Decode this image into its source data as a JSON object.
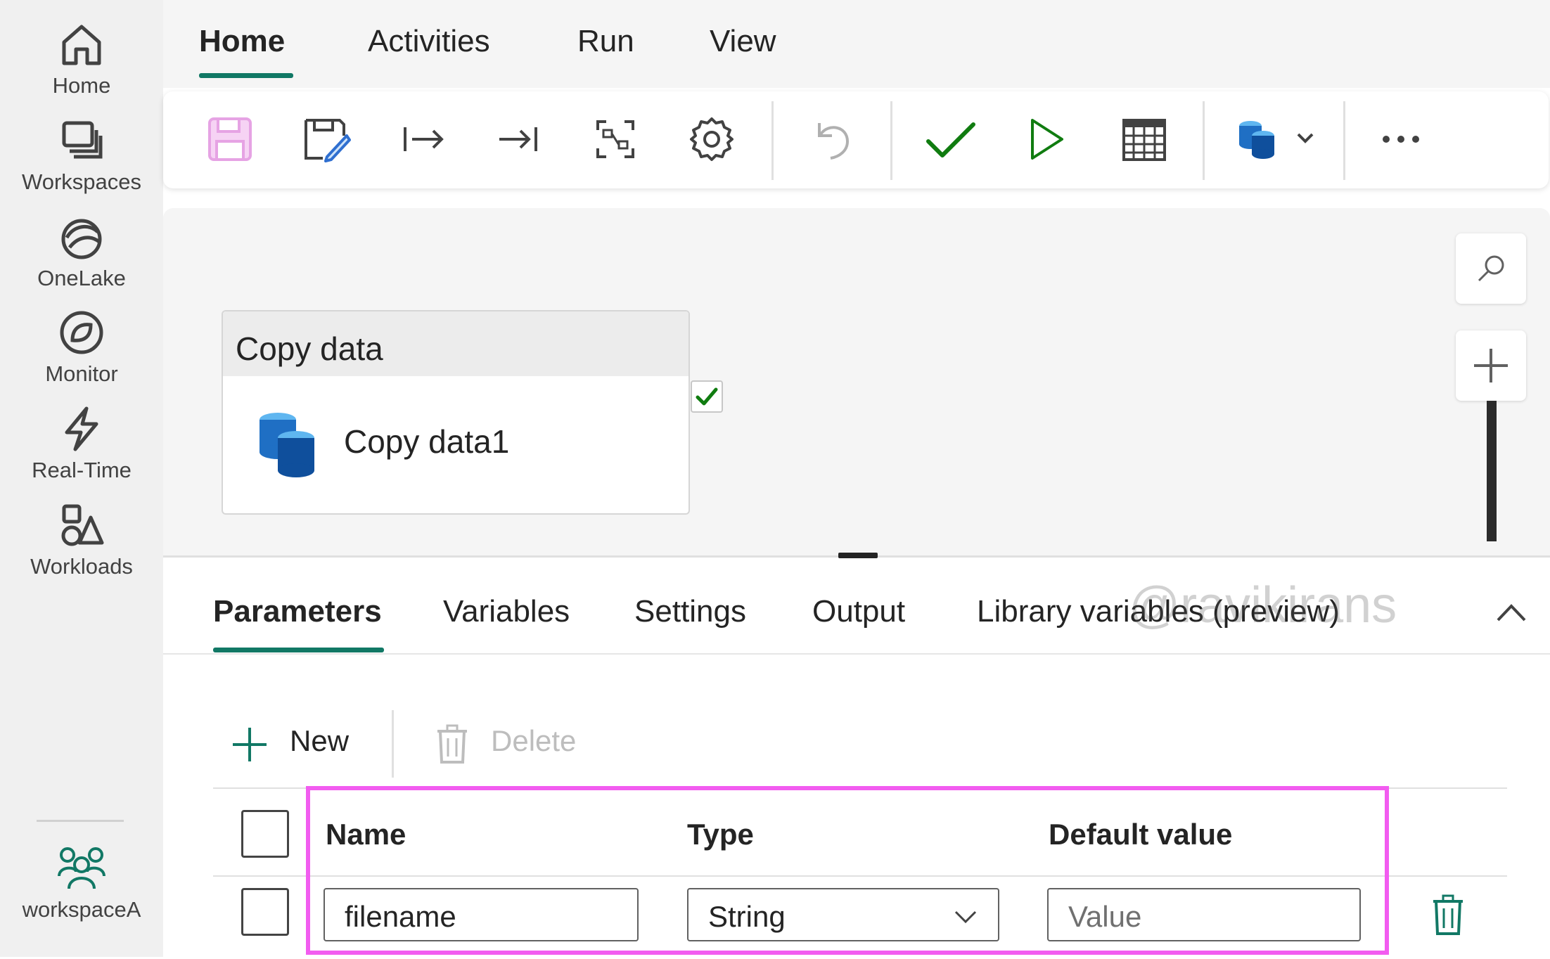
{
  "rail": {
    "items": [
      {
        "label": "Home",
        "icon": "home-icon"
      },
      {
        "label": "Workspaces",
        "icon": "workspaces-icon"
      },
      {
        "label": "OneLake",
        "icon": "onelake-icon"
      },
      {
        "label": "Monitor",
        "icon": "monitor-icon"
      },
      {
        "label": "Real-Time",
        "icon": "real-time-icon"
      },
      {
        "label": "Workloads",
        "icon": "workloads-icon"
      },
      {
        "label": "workspaceA",
        "icon": "workspace-people-icon"
      }
    ]
  },
  "menu": {
    "tabs": [
      {
        "label": "Home",
        "active": true
      },
      {
        "label": "Activities",
        "active": false
      },
      {
        "label": "Run",
        "active": false
      },
      {
        "label": "View",
        "active": false
      }
    ]
  },
  "toolbar": {
    "buttons": [
      "save-icon",
      "save-as-icon",
      "indent-icon",
      "outdent-icon",
      "auto-align-icon",
      "settings-gear-icon",
      "undo-icon",
      "validate-check-icon",
      "run-play-icon",
      "schedule-calendar-icon",
      "copy-data-dropdown-icon",
      "more-options-icon"
    ]
  },
  "canvas": {
    "activity": {
      "type_label": "Copy data",
      "name": "Copy data1"
    }
  },
  "panel": {
    "tabs": [
      {
        "label": "Parameters",
        "active": true
      },
      {
        "label": "Variables",
        "active": false
      },
      {
        "label": "Settings",
        "active": false
      },
      {
        "label": "Output",
        "active": false
      },
      {
        "label": "Library variables (preview)",
        "active": false
      }
    ],
    "commands": {
      "new_label": "New",
      "delete_label": "Delete"
    },
    "columns": {
      "name": "Name",
      "type": "Type",
      "default_value": "Default value"
    },
    "row": {
      "name_value": "filename",
      "type_value": "String",
      "default_placeholder": "Value"
    }
  },
  "watermark": "@ravikirans",
  "colors": {
    "accent": "#117865",
    "highlight": "#f25cf0",
    "success": "#107c10"
  }
}
